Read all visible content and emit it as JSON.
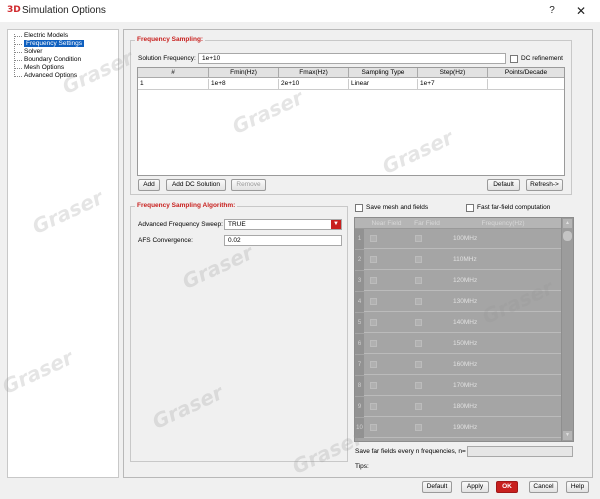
{
  "window": {
    "app_icon": "3D",
    "title": "Simulation Options",
    "help": "?",
    "close": "✕"
  },
  "tree": {
    "items": [
      {
        "label": "Electric Models"
      },
      {
        "label": "Frequency Settings"
      },
      {
        "label": "Solver"
      },
      {
        "label": "Boundary Condition"
      },
      {
        "label": "Mesh Options"
      },
      {
        "label": "Advanced Options"
      }
    ],
    "selected_index": 1
  },
  "sampling": {
    "title": "Frequency Sampling:",
    "solution_label": "Solution Frequency:",
    "solution_value": "1e+10",
    "dc_refinement_label": "DC refinement",
    "columns": [
      "#",
      "Fmin(Hz)",
      "Fmax(Hz)",
      "Sampling Type",
      "Step(Hz)",
      "Points/Decade"
    ],
    "rows": [
      [
        "1",
        "1e+8",
        "2e+10",
        "Linear",
        "1e+7",
        ""
      ]
    ],
    "buttons": {
      "add": "Add",
      "add_dc": "Add DC Solution",
      "remove": "Remove",
      "default": "Default",
      "refresh": "Refresh->"
    }
  },
  "algorithm": {
    "title": "Frequency Sampling Algorithm:",
    "afs_sweep_label": "Advanced Frequency Sweep:",
    "afs_sweep_value": "TRUE",
    "afs_conv_label": "AFS Convergence:",
    "afs_conv_value": "0.02"
  },
  "output": {
    "save_mesh_label": "Save mesh and fields",
    "fast_far_label": "Fast far-field computation",
    "columns": [
      "Near Field",
      "Far Field",
      "Frequency(Hz)"
    ],
    "frequencies": [
      "100MHz",
      "110MHz",
      "120MHz",
      "130MHz",
      "140MHz",
      "150MHz",
      "160MHz",
      "170MHz",
      "180MHz",
      "190MHz"
    ],
    "row_numbers": [
      "1",
      "2",
      "3",
      "4",
      "5",
      "6",
      "7",
      "8",
      "9",
      "10"
    ],
    "save_far_label": "Save far fields every n frequencies, n=",
    "save_far_value": "",
    "tips_label": "Tips:"
  },
  "footer": {
    "default": "Default",
    "apply": "Apply",
    "ok": "OK",
    "cancel": "Cancel",
    "help": "Help"
  },
  "watermark": "Graser",
  "colors": {
    "accent": "#c8201e",
    "selection": "#0e5fbf"
  }
}
